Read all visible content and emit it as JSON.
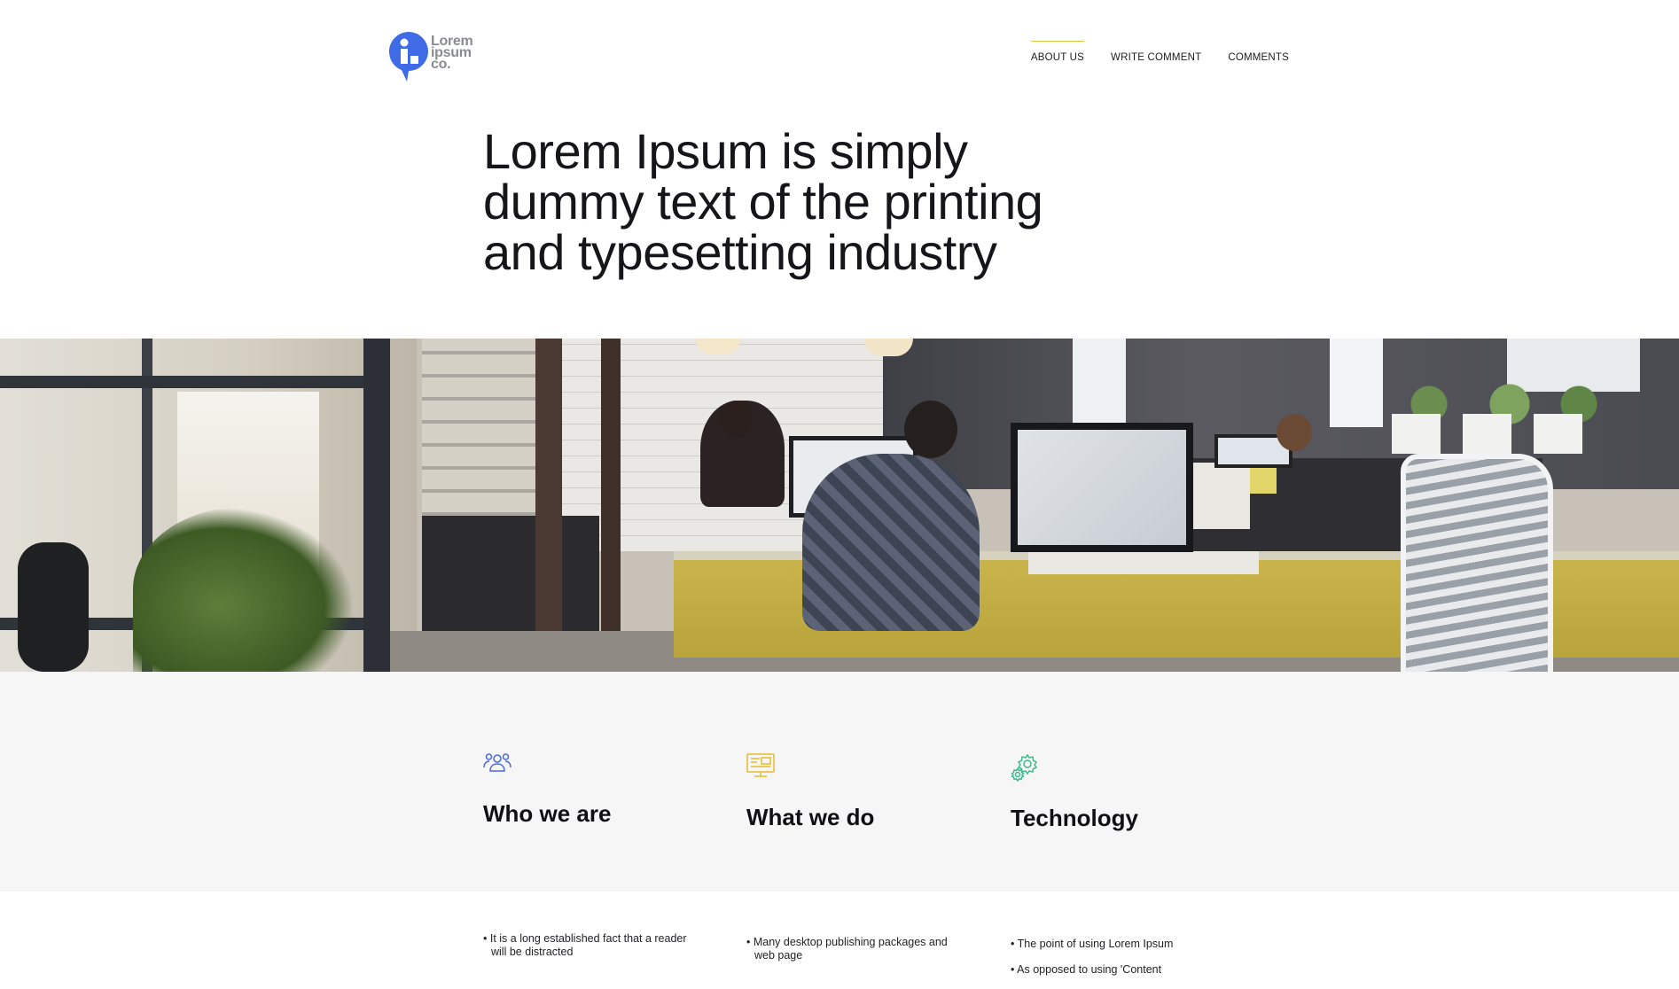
{
  "brand": {
    "logo_lines": [
      "Lorem",
      "ipsum",
      "co."
    ],
    "logo_color": "#3f6ce6",
    "logo_text_color": "#8a8b90"
  },
  "nav": {
    "items": [
      {
        "label": "ABOUT US",
        "active": true
      },
      {
        "label": "WRITE COMMENT",
        "active": false
      },
      {
        "label": "COMMENTS",
        "active": false
      }
    ],
    "active_indicator_color": "#e1c43a"
  },
  "hero": {
    "title_lines": [
      "Lorem Ipsum is simply",
      "dummy text of the printing",
      "and typesetting industry"
    ]
  },
  "features": [
    {
      "icon": "people-group-icon",
      "icon_color": "#4a68d8",
      "title": "Who we are",
      "bullets": [
        "It is a long established fact that a reader will be distracted"
      ]
    },
    {
      "icon": "presentation-board-icon",
      "icon_color": "#e6bb27",
      "title": "What we do",
      "bullets": [
        "Many desktop publishing packages and web page"
      ]
    },
    {
      "icon": "gears-icon",
      "icon_color": "#3fb98a",
      "title": "Technology",
      "bullets": [
        "The point of using Lorem Ipsum",
        "As opposed to using 'Content"
      ]
    }
  ]
}
